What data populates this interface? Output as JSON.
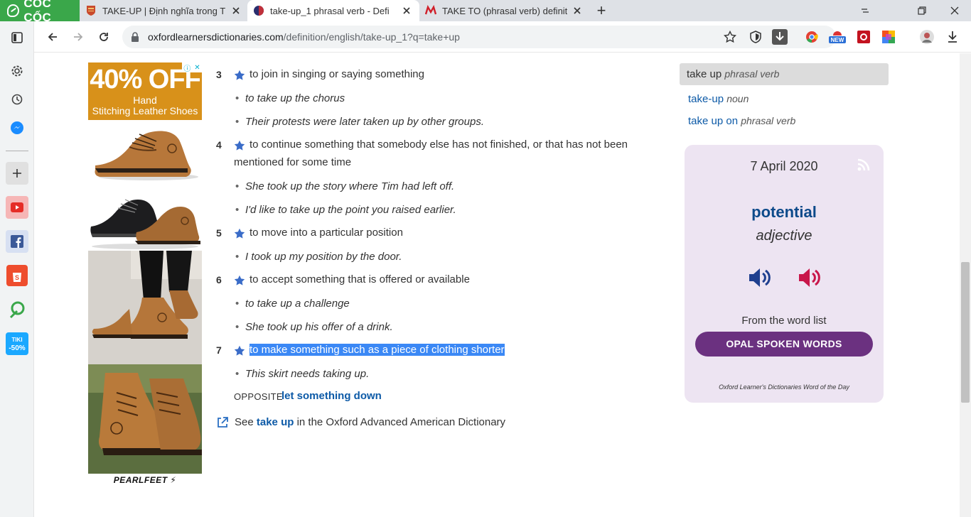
{
  "browser": {
    "brand": "CỐC CỐC",
    "tabs": [
      {
        "title": "TAKE-UP | Định nghĩa trong T",
        "active": false
      },
      {
        "title": "take-up_1 phrasal verb - Defi",
        "active": true
      },
      {
        "title": "TAKE TO (phrasal verb) definit",
        "active": false
      }
    ],
    "url_host": "oxfordlearnersdictionaries.com",
    "url_path": "/definition/english/take-up_1?q=take+up"
  },
  "colors": {
    "brand_green": "#3aa74a",
    "link_blue": "#0d5aa7",
    "wotd_purple": "#6b3180",
    "selection": "#3b88f5"
  },
  "ad": {
    "headline": "40% OFF",
    "line1": "Hand",
    "line2": "Stitching Leather Shoes",
    "brand": "PEARLFEET"
  },
  "senses": [
    {
      "num": "3",
      "definition": "to join in singing or saying something",
      "examples": [
        "to take up the chorus",
        "Their protests were later taken up by other groups."
      ]
    },
    {
      "num": "4",
      "definition_line1": "to continue something that somebody else has not finished, or that has not been",
      "definition_line2": "mentioned for some time",
      "examples": [
        "She took up the story where Tim had left off.",
        "I'd like to take up the point you raised earlier."
      ]
    },
    {
      "num": "5",
      "definition": "to move into a particular position",
      "examples": [
        "I took up my position by the door."
      ]
    },
    {
      "num": "6",
      "definition": "to accept something that is offered or available",
      "examples": [
        "to take up a challenge",
        "She took up his offer of a drink."
      ]
    },
    {
      "num": "7",
      "definition": "to make something such as a piece of clothing shorter",
      "examples": [
        "This skirt needs taking up."
      ]
    }
  ],
  "opposite": {
    "label": "OPPOSITE",
    "link": "let something down"
  },
  "see_also": {
    "prefix": "See",
    "link": "take up",
    "suffix": "in the Oxford Advanced American Dictionary"
  },
  "related": [
    {
      "word": "take up",
      "pos": "phrasal verb",
      "selected": true
    },
    {
      "word": "take-up",
      "pos": "noun",
      "selected": false
    },
    {
      "word": "take up on",
      "pos": "phrasal verb",
      "selected": false
    }
  ],
  "word_of_the_day": {
    "date": "7 April 2020",
    "word": "potential",
    "pos": "adjective",
    "from_label": "From the word list",
    "list_button": "OPAL SPOKEN WORDS",
    "footer": "Oxford Learner's Dictionaries Word of the Day"
  }
}
